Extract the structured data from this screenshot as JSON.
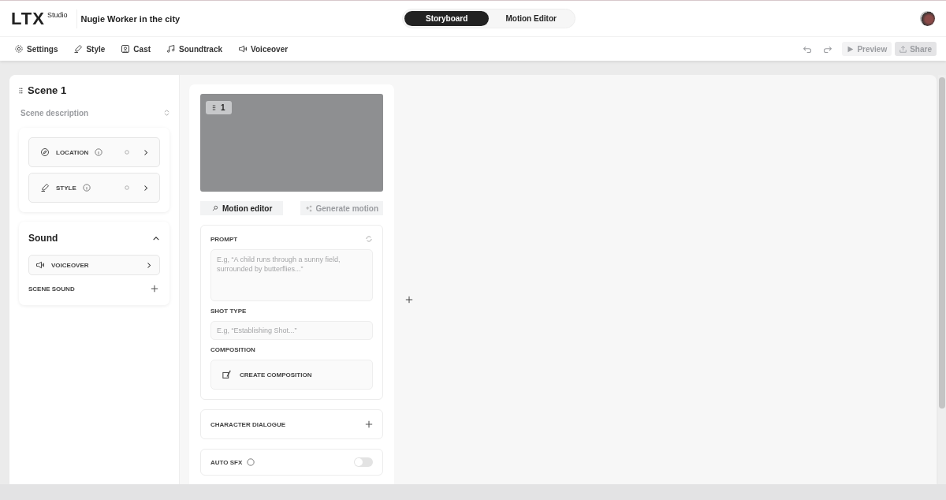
{
  "header": {
    "logo": "LTX",
    "logo_sub": "Studio",
    "project_title": "Nugie Worker in the city",
    "view_tabs": [
      {
        "label": "Storyboard",
        "selected": true
      },
      {
        "label": "Motion Editor",
        "selected": false
      }
    ]
  },
  "toolbar": {
    "items": [
      {
        "label": "Settings",
        "kind": "gear"
      },
      {
        "label": "Style",
        "kind": "brush"
      },
      {
        "label": "Cast",
        "kind": "person"
      },
      {
        "label": "Soundtrack",
        "kind": "music"
      },
      {
        "label": "Voiceover",
        "kind": "megaphone"
      }
    ],
    "preview": {
      "label": "Preview",
      "disabled": true
    },
    "share": {
      "label": "Share",
      "disabled": true
    }
  },
  "scene": {
    "title": "Scene 1",
    "description_placeholder": "Scene description",
    "attributes": [
      {
        "label": "LOCATION",
        "kind": "compass"
      },
      {
        "label": "STYLE",
        "kind": "brush"
      }
    ]
  },
  "sound": {
    "title": "Sound",
    "expanded": true,
    "items": [
      {
        "kind": "row",
        "label": "VOICEOVER"
      },
      {
        "kind": "add",
        "label": "SCENE SOUND"
      }
    ]
  },
  "shot": {
    "number": "1",
    "actions": [
      {
        "label": "Motion editor",
        "disabled": false
      },
      {
        "label": "Generate motion",
        "disabled": true
      }
    ],
    "prompt": {
      "label": "PROMPT",
      "placeholder": "E.g, “A child runs through a sunny field, surrounded by butterflies...”"
    },
    "shot_type": {
      "label": "SHOT TYPE",
      "placeholder": "E.g, “Establishing Shot...”"
    },
    "composition": {
      "label": "COMPOSITION",
      "button": "CREATE COMPOSITION"
    },
    "dialogue": {
      "label": "CHARACTER DIALOGUE"
    },
    "auto_sfx": {
      "label": "AUTO SFX",
      "on": false
    }
  }
}
